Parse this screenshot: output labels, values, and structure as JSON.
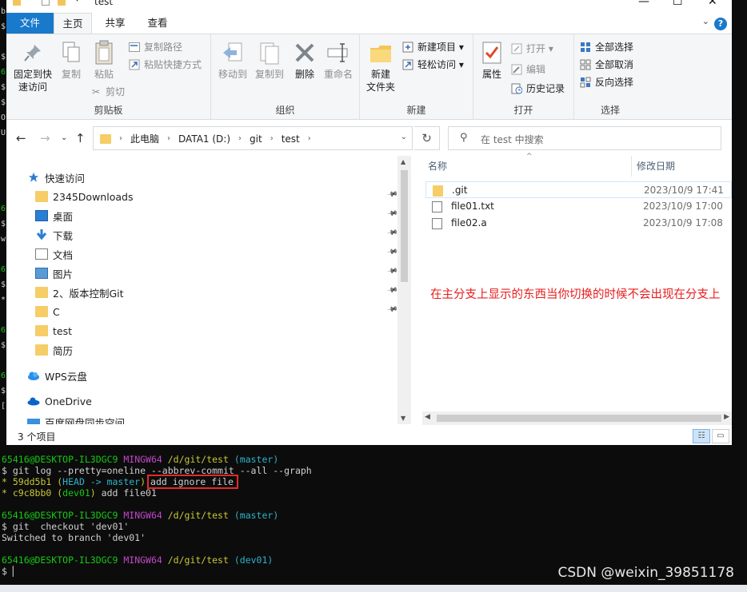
{
  "window": {
    "title": "test",
    "minimize": "—",
    "maximize": "☐",
    "close": "✕"
  },
  "ribbon_tabs": {
    "file": "文件",
    "home": "主页",
    "share": "共享",
    "view": "查看"
  },
  "ribbon": {
    "clipboard": {
      "label": "剪贴板",
      "pin": "固定到快\n速访问",
      "copy": "复制",
      "paste": "粘贴",
      "copy_path": "复制路径",
      "paste_shortcut": "粘贴快捷方式",
      "cut": "剪切"
    },
    "organize": {
      "label": "组织",
      "move_to": "移动到",
      "copy_to": "复制到",
      "delete": "删除",
      "rename": "重命名"
    },
    "new": {
      "label": "新建",
      "new_folder": "新建\n文件夹",
      "new_item": "新建项目 ▾",
      "easy_access": "轻松访问 ▾"
    },
    "open": {
      "label": "打开",
      "properties": "属性",
      "open": "打开 ▾",
      "edit": "编辑",
      "history": "历史记录"
    },
    "select": {
      "label": "选择",
      "select_all": "全部选择",
      "select_none": "全部取消",
      "invert": "反向选择"
    }
  },
  "address": {
    "crumbs": [
      "此电脑",
      "DATA1 (D:)",
      "git",
      "test"
    ],
    "search_placeholder": "在 test 中搜索"
  },
  "nav": {
    "quick_access": "快速访问",
    "items": [
      "2345Downloads",
      "桌面",
      "下载",
      "文档",
      "图片",
      "2、版本控制Git",
      "C",
      "test",
      "简历"
    ],
    "wps": "WPS云盘",
    "onedrive": "OneDrive",
    "partial": "百度网盘同步空间"
  },
  "files": {
    "col_name": "名称",
    "col_date": "修改日期",
    "rows": [
      {
        "name": ".git",
        "date": "2023/10/9 17:41"
      },
      {
        "name": "file01.txt",
        "date": "2023/10/9 17:00"
      },
      {
        "name": "file02.a",
        "date": "2023/10/9 17:08"
      }
    ],
    "annotation": "在主分支上显示的东西当你切换的时候不会出现在分支上"
  },
  "status": {
    "count": "3 个项目"
  },
  "terminal": {
    "prompt_user": "65416@DESKTOP-IL3DGC9",
    "prompt_env": "MINGW64",
    "path": "/d/git/test",
    "branch_master": "(master)",
    "branch_dev": "(dev01)",
    "cmd1": "$ git log --pretty=oneline --abbrev-commit --all --graph",
    "log1_hash": "* 59dd5b1",
    "log1_open": " (",
    "log1_head": "HEAD -> master",
    "log1_close": ")",
    "log1_msg": "add ignore file",
    "log2_hash": "* c9c8bb0",
    "log2_open": " (",
    "log2_ref": "dev01",
    "log2_close": ")",
    "log2_msg": " add file01",
    "cmd2": "$ git  checkout 'dev01'",
    "output2": "Switched to branch 'dev01'",
    "prompt_end": "$ ",
    "edge_chars": [
      "b",
      "$",
      "",
      "$",
      "6",
      "$",
      "$",
      "O",
      "U",
      "",
      "",
      "",
      "",
      "6",
      "$",
      "w",
      "",
      "6",
      "$",
      "*",
      "",
      "6",
      "$",
      "",
      "6",
      "$",
      "[",
      ""
    ]
  },
  "watermark": "CSDN @weixin_39851178"
}
